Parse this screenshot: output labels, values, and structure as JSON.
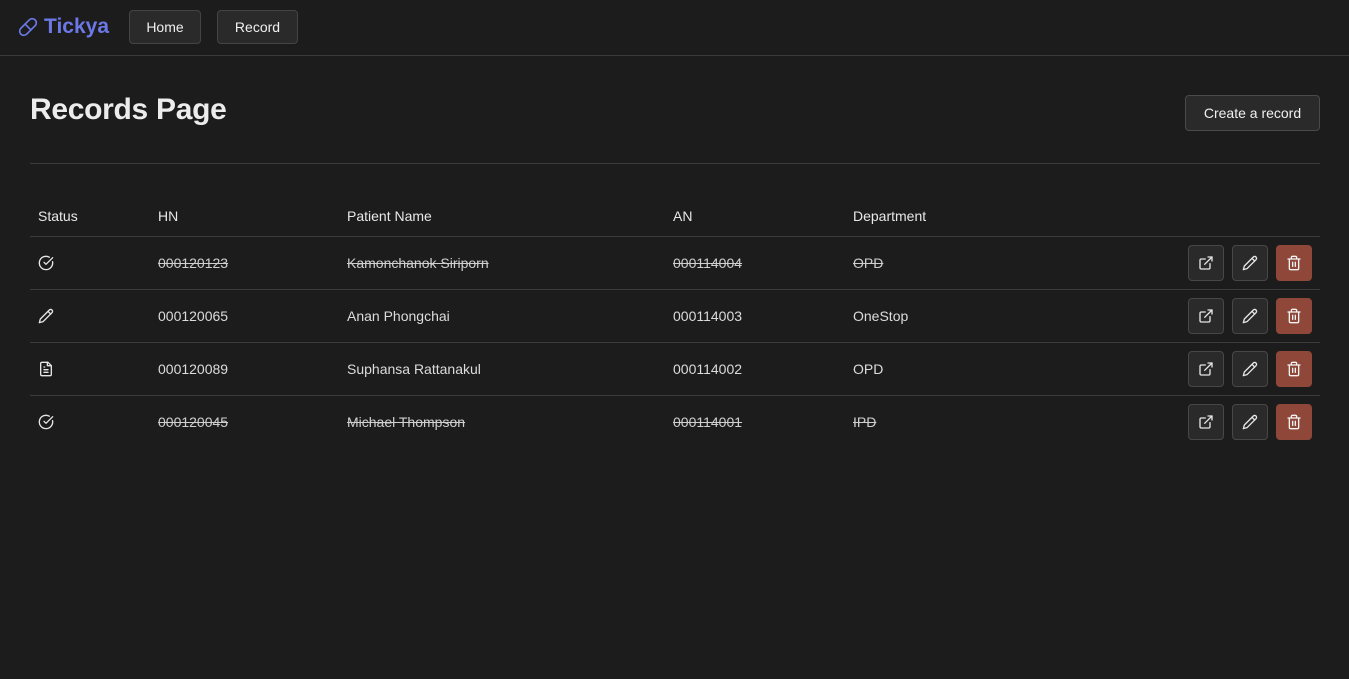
{
  "app": {
    "brand_name": "Tickya",
    "brand_color": "#6b78e6",
    "nav": [
      {
        "label": "Home"
      },
      {
        "label": "Record"
      }
    ]
  },
  "page": {
    "title": "Records Page",
    "create_button_label": "Create a record"
  },
  "table": {
    "columns": [
      "Status",
      "HN",
      "Patient Name",
      "AN",
      "Department"
    ],
    "rows": [
      {
        "status": "completed",
        "status_icon": "check-circle-icon",
        "hn": "000120123",
        "name": "Kamonchanok Siriporn",
        "an": "000114004",
        "department": "OPD",
        "struck": true
      },
      {
        "status": "editing",
        "status_icon": "pencil-icon",
        "hn": "000120065",
        "name": "Anan Phongchai",
        "an": "000114003",
        "department": "OneStop",
        "struck": false
      },
      {
        "status": "document",
        "status_icon": "document-icon",
        "hn": "000120089",
        "name": "Suphansa Rattanakul",
        "an": "000114002",
        "department": "OPD",
        "struck": false
      },
      {
        "status": "completed",
        "status_icon": "check-circle-icon",
        "hn": "000120045",
        "name": "Michael Thompson",
        "an": "000114001",
        "department": "IPD",
        "struck": true
      }
    ],
    "row_actions": [
      "open-external-icon",
      "pencil-icon",
      "trash-icon"
    ],
    "delete_color": "#8e4739"
  }
}
